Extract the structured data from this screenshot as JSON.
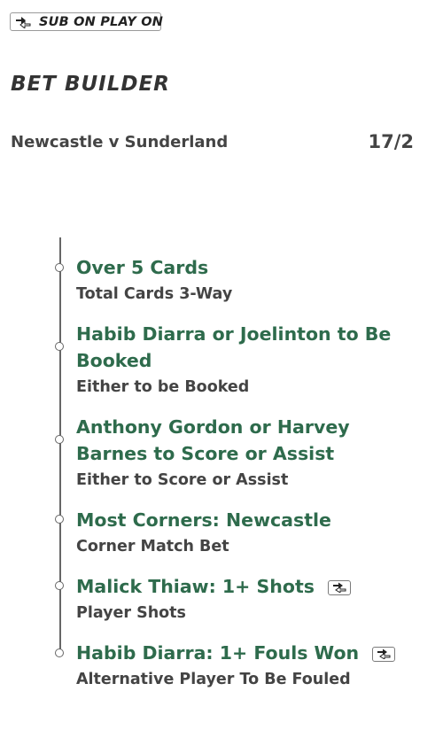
{
  "badge": {
    "label": "SUB ON PLAY ON",
    "icon": "swap-icon"
  },
  "header": {
    "title": "BET BUILDER"
  },
  "match": {
    "name": "Newcastle v Sunderland",
    "odds": "17/2"
  },
  "colors": {
    "selection_title": "#2e6b4c",
    "text": "#444444"
  },
  "selections": [
    {
      "title": "Over 5 Cards",
      "market": "Total Cards 3-Way"
    },
    {
      "title": "Habib Diarra or  Joelinton to Be Booked",
      "market": "Either to be Booked"
    },
    {
      "title": "Anthony Gordon or Harvey Barnes to Score or Assist",
      "market": "Either to Score or Assist"
    },
    {
      "title": "Most Corners: Newcastle",
      "market": "Corner Match Bet"
    },
    {
      "title": "Malick Thiaw: 1+ Shots",
      "market": "Player Shots",
      "icon": "swap-icon"
    },
    {
      "title": "Habib Diarra: 1+ Fouls Won",
      "market": "Alternative Player To Be Fouled",
      "icon": "swap-icon"
    }
  ]
}
